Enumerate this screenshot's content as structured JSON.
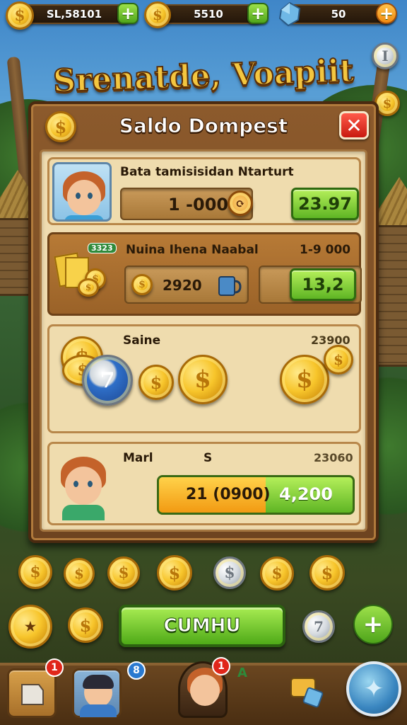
{
  "top_bar": {
    "gold_value": "SL,58101",
    "coin_value": "5510",
    "gem_value": "50"
  },
  "game_title": "Srenatde, Voapiit",
  "panel": {
    "title": "Saldo Dompest",
    "rows": [
      {
        "label": "Bata tamisisidan Ntarturt",
        "amount": "1 -000",
        "button": "23.97"
      },
      {
        "badge": "3323",
        "label": "Nuina Ihena Naabal",
        "amount_right": "1-9 000",
        "amount": "2920",
        "button": "13,2"
      },
      {
        "label": "Saine",
        "amount_right": "23900",
        "chip": "7"
      },
      {
        "label": "Marl",
        "sign": "S",
        "amount_right": "23060",
        "progress_text": "21 (0900)",
        "progress_value": "4,200",
        "progress_fraction": 0.55
      }
    ]
  },
  "main_button": "CUMHU",
  "floor_coin_label": "7",
  "bottom_nav": {
    "badges": [
      "1",
      "8",
      "1"
    ],
    "extra_label": "A"
  },
  "colors": {
    "accent_gold": "#f3c640",
    "button_green": "#5fb524",
    "close_red": "#e0261a"
  },
  "icons": [
    "coin-icon",
    "plus-icon",
    "gem-icon",
    "close-icon",
    "star-icon",
    "settings-icon"
  ]
}
